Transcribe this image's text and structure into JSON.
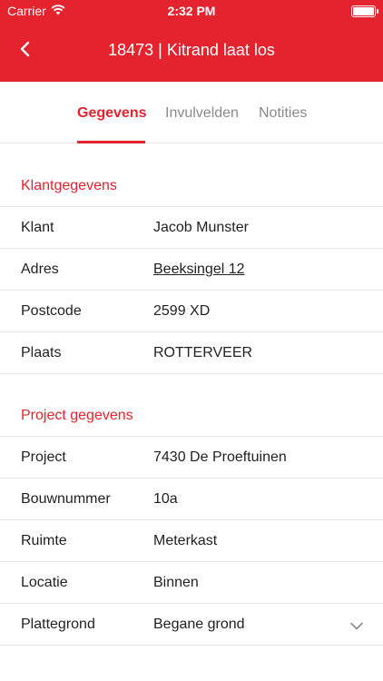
{
  "status_bar": {
    "carrier": "Carrier",
    "time": "2:32 PM",
    "battery_level": 1.0
  },
  "nav": {
    "title": "18473 | Kitrand laat los"
  },
  "tabs": [
    {
      "label": "Gegevens",
      "active": true
    },
    {
      "label": "Invulvelden",
      "active": false
    },
    {
      "label": "Notities",
      "active": false
    }
  ],
  "klant_section": {
    "title": "Klantgegevens",
    "rows": [
      {
        "label": "Klant",
        "value": "Jacob Munster"
      },
      {
        "label": "Adres",
        "value": "Beeksingel 12"
      },
      {
        "label": "Postcode",
        "value": "2599 XD"
      },
      {
        "label": "Plaats",
        "value": "ROTTERVEER"
      }
    ]
  },
  "project_section": {
    "title": "Project gegevens",
    "rows": [
      {
        "label": "Project",
        "value": "7430 De Proeftuinen"
      },
      {
        "label": "Bouwnummer",
        "value": "10a"
      },
      {
        "label": "Ruimte",
        "value": "Meterkast"
      },
      {
        "label": "Locatie",
        "value": "Binnen"
      },
      {
        "label": "Plattegrond",
        "value": "Begane grond"
      }
    ]
  },
  "icons": {
    "wifi": "wifi-icon",
    "battery": "battery-icon",
    "back": "back-chevron-icon",
    "dropdown": "chevron-down-icon"
  },
  "colors": {
    "accent": "#e5232e",
    "divider": "#e6e6e6",
    "inactive_tab": "#8a8a8a"
  }
}
